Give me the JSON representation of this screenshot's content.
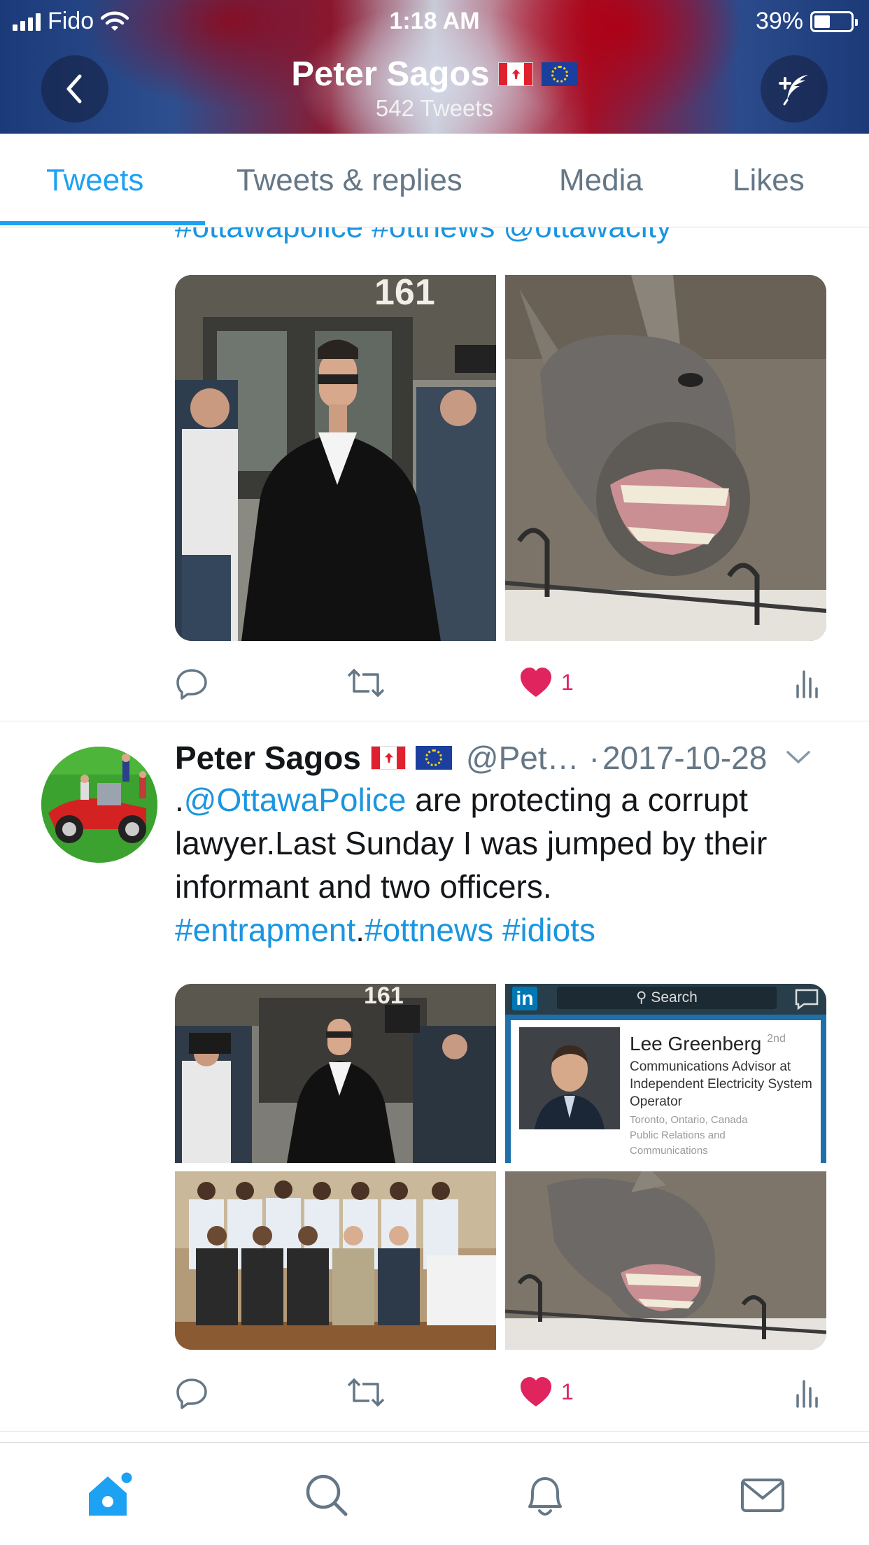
{
  "status_bar": {
    "carrier": "Fido",
    "time": "1:18 AM",
    "battery": "39%"
  },
  "header": {
    "name": "Peter Sagos",
    "tweet_count": "542 Tweets",
    "back_icon": "chevron-left-icon",
    "compose_icon": "compose-tweet-icon"
  },
  "tabs": [
    {
      "label": "Tweets",
      "active": true
    },
    {
      "label": "Tweets & replies",
      "active": false
    },
    {
      "label": "Media",
      "active": false
    },
    {
      "label": "Likes",
      "active": false
    }
  ],
  "previous_tweet": {
    "hashtags_line": "#ottawapolice #ottnews @ottawacity",
    "images": [
      "lawyer-in-robes-photo",
      "donkey-laughing-photo"
    ],
    "image_text": "161",
    "like_count": "1"
  },
  "tweet": {
    "name": "Peter Sagos",
    "handle": "@Pet…",
    "separator": "·",
    "date": "2017-10-28",
    "text_prefix": ".",
    "mention": "@OttawaPolice",
    "text_main": " are protecting a corrupt lawyer.Last Sunday I was jumped by their informant and two officers.",
    "hashtag1": "#entrapment",
    "text_dot": ".",
    "hashtag2": "#ottnews",
    "hashtag3": "#idiots",
    "like_count": "1",
    "images": [
      "lawyer-in-robes-photo",
      "linkedin-profile-screenshot",
      "police-group-photo",
      "donkey-laughing-photo"
    ],
    "image_text": "161",
    "linkedin": {
      "logo": "in",
      "search": "Search",
      "name": "Lee Greenberg",
      "degree": "2nd",
      "title": "Communications Advisor at Independent Electricity System Operator",
      "location": "Toronto, Ontario, Canada",
      "industry": "Public Relations and Communications"
    }
  },
  "bottom_nav": [
    "home-icon",
    "search-icon",
    "notifications-bell-icon",
    "messages-envelope-icon"
  ],
  "colors": {
    "accent": "#1da1f2",
    "link": "#1b95e0",
    "like": "#e0245e",
    "secondary_text": "#657786"
  }
}
